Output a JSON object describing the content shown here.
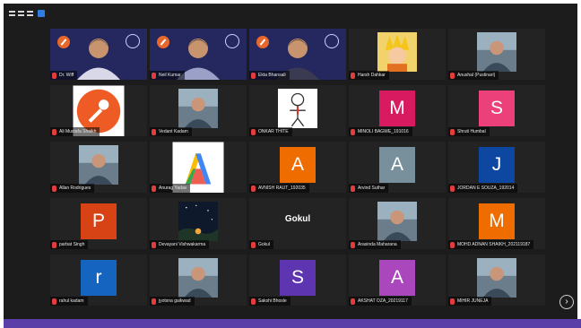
{
  "participants": [
    {
      "name": "Dr. Wiff",
      "type": "camera"
    },
    {
      "name": "Neil Kumar",
      "type": "camera"
    },
    {
      "name": "Ekta Bhansali",
      "type": "camera"
    },
    {
      "name": "Harsh Dahkar",
      "type": "image",
      "picture": "cartoon-character"
    },
    {
      "name": "Anushal (Pustinari)",
      "type": "image",
      "picture": "person-photo"
    },
    {
      "name": "Ali Mustafa Shaikh",
      "type": "image",
      "picture": "postman-logo"
    },
    {
      "name": "Vedant Kadam",
      "type": "image",
      "picture": "person-photo"
    },
    {
      "name": "ONKAR THITE",
      "type": "image",
      "picture": "drawing"
    },
    {
      "name": "MINOLI BAGWE_191016",
      "type": "initial",
      "letter": "M",
      "color": "#d81b60"
    },
    {
      "name": "Shruti Humbal",
      "type": "initial",
      "letter": "S",
      "color": "#ec407a"
    },
    {
      "name": "Allan Rodrigues",
      "type": "image",
      "picture": "person-photo"
    },
    {
      "name": "Anurag Yadav",
      "type": "image",
      "picture": "google-ads-logo"
    },
    {
      "name": "AVNISH RAUT_192035",
      "type": "initial",
      "letter": "A",
      "color": "#ef6c00"
    },
    {
      "name": "Arvind Suthar",
      "type": "initial",
      "letter": "A",
      "color": "#78909c"
    },
    {
      "name": "JORDAN E SOUZA_192014",
      "type": "initial",
      "letter": "J",
      "color": "#0d47a1"
    },
    {
      "name": "parbat Singh",
      "type": "initial",
      "letter": "P",
      "color": "#d84315"
    },
    {
      "name": "Devayani Vishwakarma",
      "type": "image",
      "picture": "night-scene"
    },
    {
      "name": "Gokul",
      "type": "text",
      "label": "Gokul"
    },
    {
      "name": "Arasinda Maharana",
      "type": "image",
      "picture": "person-photo"
    },
    {
      "name": "MOHD ADNAN SHAIKH_202119187",
      "type": "initial",
      "letter": "M",
      "color": "#ef6c00"
    },
    {
      "name": "rahul kadam",
      "type": "initial",
      "letter": "r",
      "color": "#1565c0"
    },
    {
      "name": "jyotsna gaikwad",
      "type": "image",
      "picture": "person-photo"
    },
    {
      "name": "Sakshi Bhosle",
      "type": "initial",
      "letter": "S",
      "color": "#5e35b1"
    },
    {
      "name": "AKSHAT OZA_20219117",
      "type": "initial",
      "letter": "A",
      "color": "#ab47bc"
    },
    {
      "name": "MIHIR JUNEJA",
      "type": "image",
      "picture": "person-photo"
    }
  ],
  "controls": {
    "next_page_icon": "chevron-right-icon",
    "next_page_glyph": "›"
  },
  "colors": {
    "background": "#1c1c1c",
    "active_speaker": "#9fd84b",
    "muted_mic": "#e23d3d",
    "bottom_bar": "#5b3fa8"
  }
}
